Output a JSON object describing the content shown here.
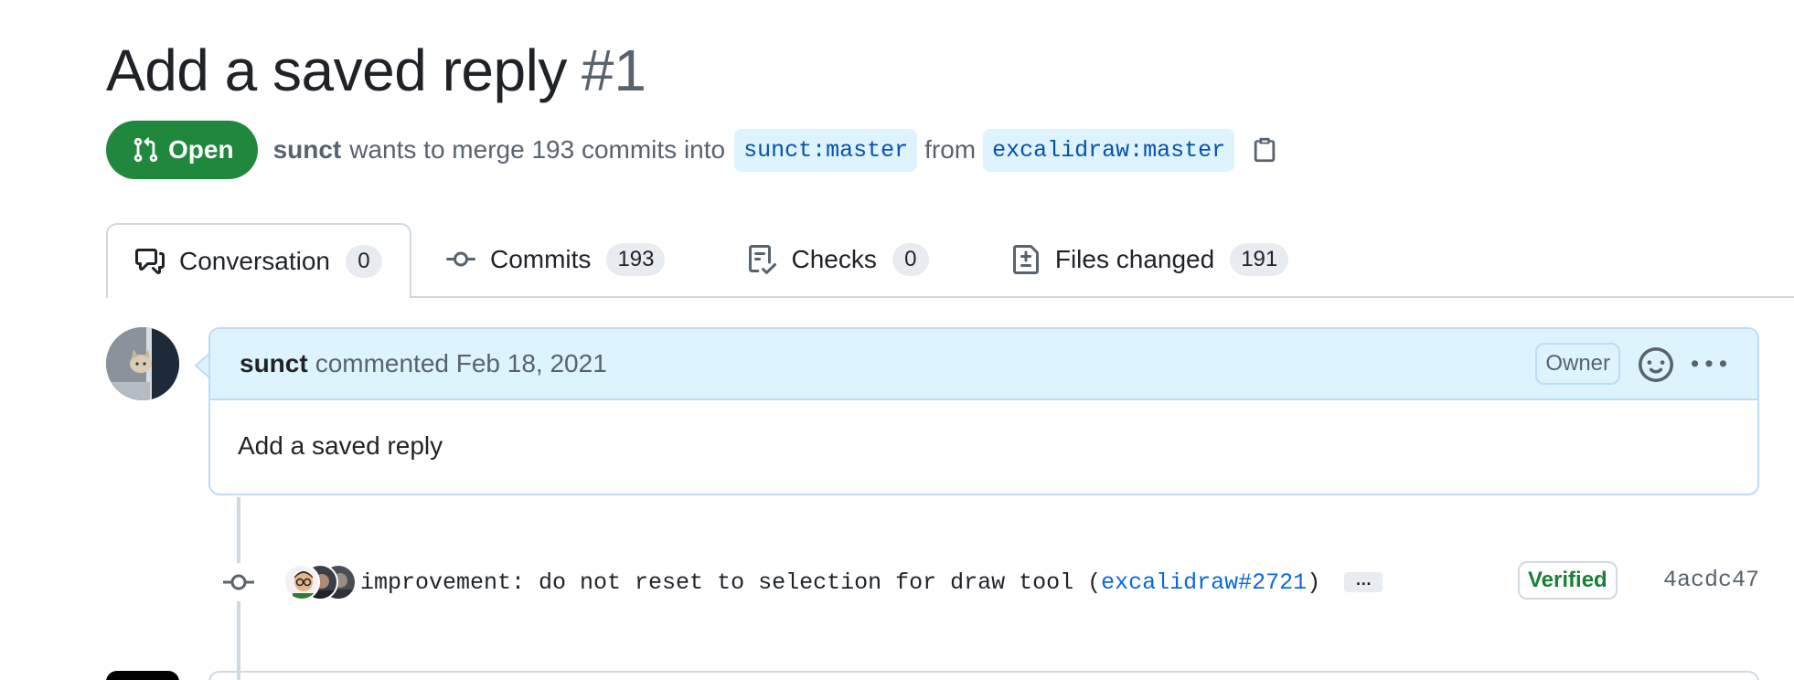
{
  "pr": {
    "title": "Add a saved reply",
    "number": "#1",
    "state": "Open",
    "author": "sunct",
    "merge_text": "wants to merge 193 commits into",
    "base_branch": "sunct:master",
    "from_text": "from",
    "head_branch": "excalidraw:master"
  },
  "tabs": [
    {
      "label": "Conversation",
      "count": "0",
      "icon": "comment-discussion-icon"
    },
    {
      "label": "Commits",
      "count": "193",
      "icon": "git-commit-icon"
    },
    {
      "label": "Checks",
      "count": "0",
      "icon": "checklist-icon"
    },
    {
      "label": "Files changed",
      "count": "191",
      "icon": "file-diff-icon"
    }
  ],
  "comment": {
    "author": "sunct",
    "action": "commented Feb 18, 2021",
    "role_badge": "Owner",
    "body": "Add a saved reply"
  },
  "commit": {
    "message": "improvement: do not reset to selection for draw tool (",
    "link": "excalidraw#2721",
    "message_end": ")",
    "expand_label": "…",
    "verified_label": "Verified",
    "sha": "4acdc47"
  },
  "colors": {
    "open_green": "#1f883d",
    "link_blue": "#0969da",
    "branch_bg": "#ddf4ff",
    "verified_green": "#1a7f37"
  }
}
